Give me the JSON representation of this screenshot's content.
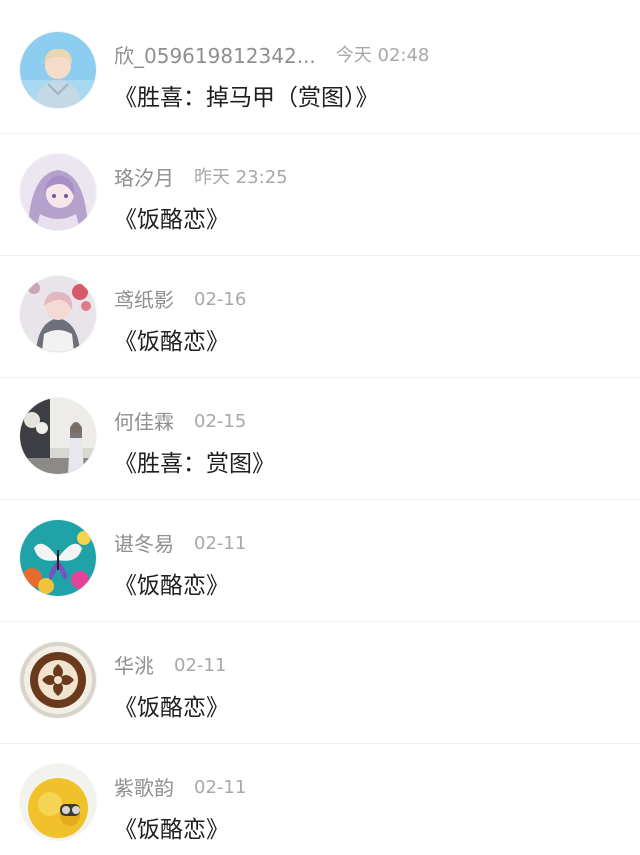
{
  "items": [
    {
      "name": "欣_059619812342...",
      "time": "今天 02:48",
      "message": "《胜喜：掉马甲（赏图）》",
      "avatar_icon": "anime-boy-hoodie-avatar"
    },
    {
      "name": "珞汐月",
      "time": "昨天 23:25",
      "message": "《饭酪恋》",
      "avatar_icon": "anime-girl-purple-avatar"
    },
    {
      "name": "鸢纸影",
      "time": "02-16",
      "message": "《饭酪恋》",
      "avatar_icon": "anime-boy-flowers-avatar"
    },
    {
      "name": "何佳霖",
      "time": "02-15",
      "message": "《胜喜：赏图》",
      "avatar_icon": "girl-photo-room-avatar"
    },
    {
      "name": "谌冬易",
      "time": "02-11",
      "message": "《饭酪恋》",
      "avatar_icon": "butterfly-flowers-avatar"
    },
    {
      "name": "华洮",
      "time": "02-11",
      "message": "《饭酪恋》",
      "avatar_icon": "coffee-latte-art-avatar"
    },
    {
      "name": "紫歌韵",
      "time": "02-11",
      "message": "《饭酪恋》",
      "avatar_icon": "yellow-chick-avatar"
    }
  ]
}
